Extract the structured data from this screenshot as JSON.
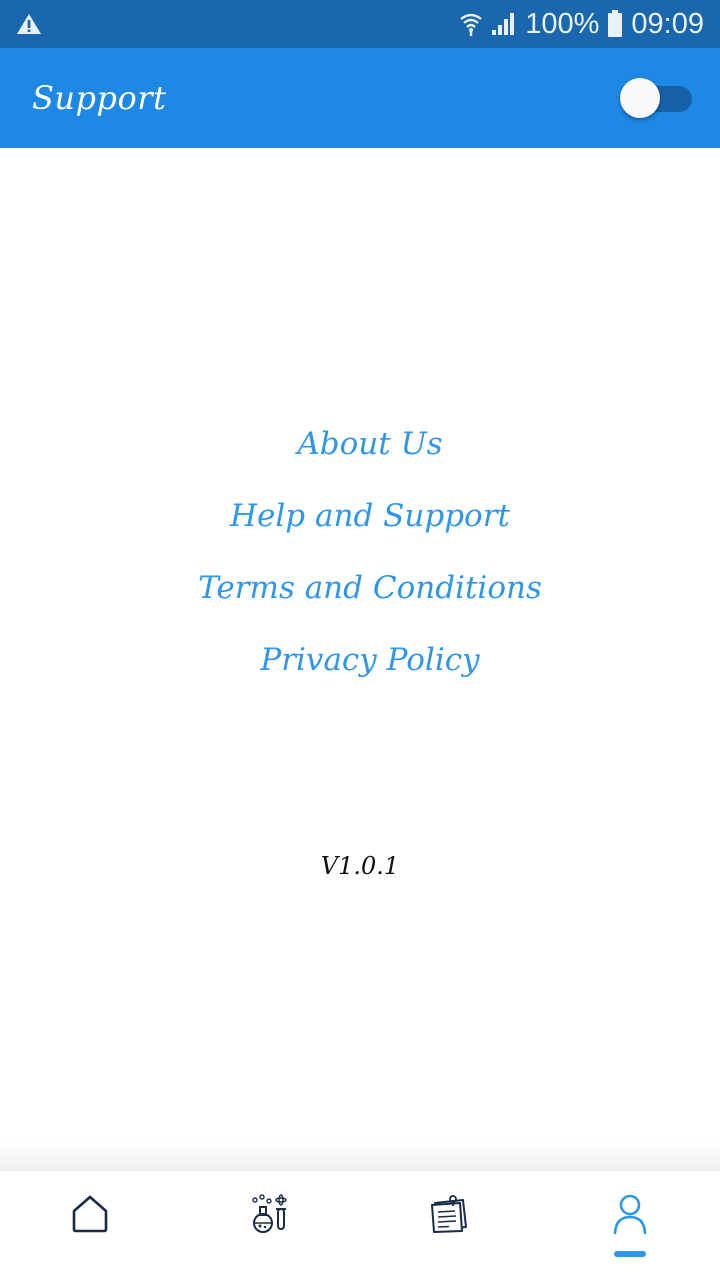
{
  "status_bar": {
    "battery": "100%",
    "time": "09:09",
    "icons": [
      "warning-icon",
      "wifi-icon",
      "signal-icon",
      "battery-icon"
    ]
  },
  "app_bar": {
    "title": "Support",
    "toggle_on": false
  },
  "menu": {
    "items": [
      {
        "label": "About Us"
      },
      {
        "label": "Help and Support"
      },
      {
        "label": "Terms and Conditions"
      },
      {
        "label": "Privacy Policy"
      }
    ]
  },
  "version": "V1.0.1",
  "bottom_nav": {
    "items": [
      {
        "icon": "home-icon",
        "active": false
      },
      {
        "icon": "lab-icon",
        "active": false
      },
      {
        "icon": "notes-icon",
        "active": false
      },
      {
        "icon": "profile-icon",
        "active": true
      }
    ]
  },
  "colors": {
    "status_bar": "#1a67ad",
    "app_bar": "#1e88e5",
    "link": "#2f96ec",
    "nav_icon": "#1b2b45",
    "nav_active": "#2f96ec"
  }
}
